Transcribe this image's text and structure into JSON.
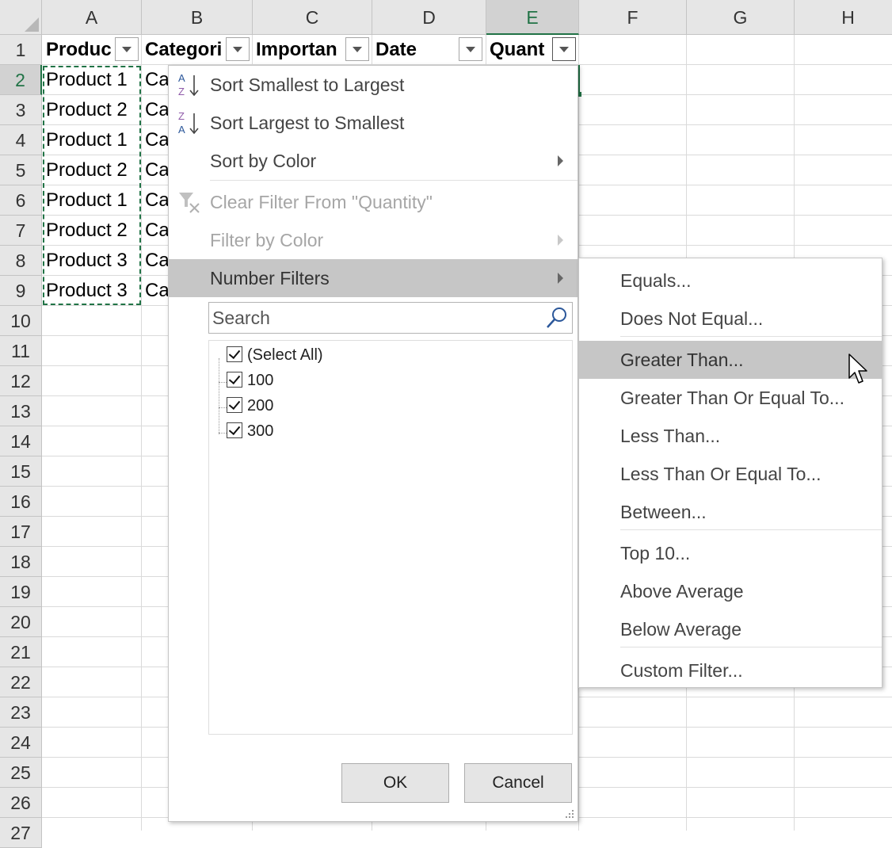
{
  "columns": [
    "A",
    "B",
    "C",
    "D",
    "E",
    "F",
    "G",
    "H"
  ],
  "rows": [
    "1",
    "2",
    "3",
    "4",
    "5",
    "6",
    "7",
    "8",
    "9",
    "10",
    "11",
    "12",
    "13",
    "14",
    "15",
    "16",
    "17",
    "18",
    "19",
    "20",
    "21",
    "22",
    "23",
    "24",
    "25",
    "26",
    "27"
  ],
  "headers": [
    "Produc",
    "Categori",
    "Importan",
    "Date",
    "Quant"
  ],
  "cells": {
    "a": [
      "Product 1",
      "Product 2",
      "Product 1",
      "Product 2",
      "Product 1",
      "Product 2",
      "Product 3",
      "Product 3"
    ],
    "b": [
      "Ca",
      "Ca",
      "Ca",
      "Ca",
      "Ca",
      "Ca",
      "Ca",
      "Ca"
    ]
  },
  "menu": {
    "sort_asc": "Sort Smallest to Largest",
    "sort_desc": "Sort Largest to Smallest",
    "sort_color": "Sort by Color",
    "clear_filter": "Clear Filter From \"Quantity\"",
    "filter_color": "Filter by Color",
    "number_filters": "Number Filters",
    "search_placeholder": "Search",
    "items": [
      "(Select All)",
      "100",
      "200",
      "300"
    ],
    "ok": "OK",
    "cancel": "Cancel"
  },
  "submenu": {
    "equals": "Equals...",
    "not_equal": "Does Not Equal...",
    "greater": "Greater Than...",
    "greater_eq": "Greater Than Or Equal To...",
    "less": "Less Than...",
    "less_eq": "Less Than Or Equal To...",
    "between": "Between...",
    "top10": "Top 10...",
    "above_avg": "Above Average",
    "below_avg": "Below Average",
    "custom": "Custom Filter..."
  },
  "colors": {
    "accent": "#217346",
    "highlight": "#c6c6c6"
  }
}
